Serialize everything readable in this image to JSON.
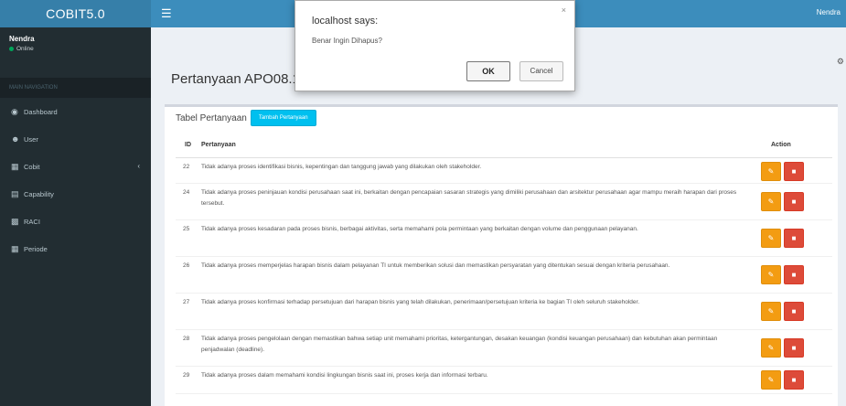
{
  "header": {
    "app_title": "COBIT5.0",
    "menu_icon": "hamburger-icon",
    "user_label": "Nendra"
  },
  "sidebar": {
    "user": {
      "name": "Nendra",
      "status": "Online"
    },
    "nav_header": "MAIN NAVIGATION",
    "items": [
      {
        "label": "Dashboard",
        "icon": "dashboard-icon"
      },
      {
        "label": "User",
        "icon": "user-icon"
      },
      {
        "label": "Cobit",
        "icon": "list-icon",
        "has_submenu": true
      },
      {
        "label": "Capability",
        "icon": "chart-icon"
      },
      {
        "label": "RACI",
        "icon": "table-icon"
      },
      {
        "label": "Periode",
        "icon": "calendar-icon"
      }
    ]
  },
  "main": {
    "page_title": "Pertanyaan APO08.1",
    "box_title": "Tabel Pertanyaan",
    "add_button": "Tambah Pertanyaan",
    "columns": {
      "id": "ID",
      "question": "Pertanyaan",
      "action": "Action"
    },
    "rows": [
      {
        "id": "22",
        "text": "Tidak adanya proses identifikasi bisnis, kepentingan dan tanggung jawab yang dilakukan oleh stakeholder."
      },
      {
        "id": "24",
        "text": "Tidak adanya proses peninjauan kondisi perusahaan saat ini, berkaitan dengan pencapaian sasaran strategis yang dimiliki perusahaan dan arsitektur perusahaan agar mampu meraih harapan dari proses tersebut."
      },
      {
        "id": "25",
        "text": "Tidak adanya proses kesadaran pada proses bisnis, berbagai aktivitas, serta memahami pola permintaan yang berkaitan dengan volume dan penggunaan pelayanan."
      },
      {
        "id": "26",
        "text": "Tidak adanya proses memperjelas harapan bisnis dalam pelayanan TI untuk memberikan solusi dan memastikan persyaratan yang ditentukan sesuai dengan kriteria perusahaan."
      },
      {
        "id": "27",
        "text": "Tidak adanya proses konfirmasi terhadap persetujuan dari harapan bisnis yang telah dilakukan, penerimaan/persetujuan kriteria ke bagian TI oleh seluruh stakeholder."
      },
      {
        "id": "28",
        "text": "Tidak adanya proses pengelolaan dengan memastikan bahwa setiap unit memahami prioritas, ketergantungan, desakan keuangan (kondisi keuangan perusahaan) dan kebutuhan akan permintaan penjadwalan (deadline)."
      },
      {
        "id": "29",
        "text": "Tidak adanya proses dalam memahami kondisi lingkungan bisnis saat ini, proses kerja dan informasi terbaru."
      }
    ]
  },
  "dialog": {
    "title": "localhost says:",
    "message": "Benar Ingin Dihapus?",
    "ok_label": "OK",
    "cancel_label": "Cancel"
  },
  "colors": {
    "header_bg": "#3c8dbc",
    "logo_bg": "#367fa9",
    "sidebar_bg": "#222d32",
    "edit_btn": "#f39c12",
    "delete_btn": "#dd4b39",
    "add_btn": "#00c0ef"
  }
}
